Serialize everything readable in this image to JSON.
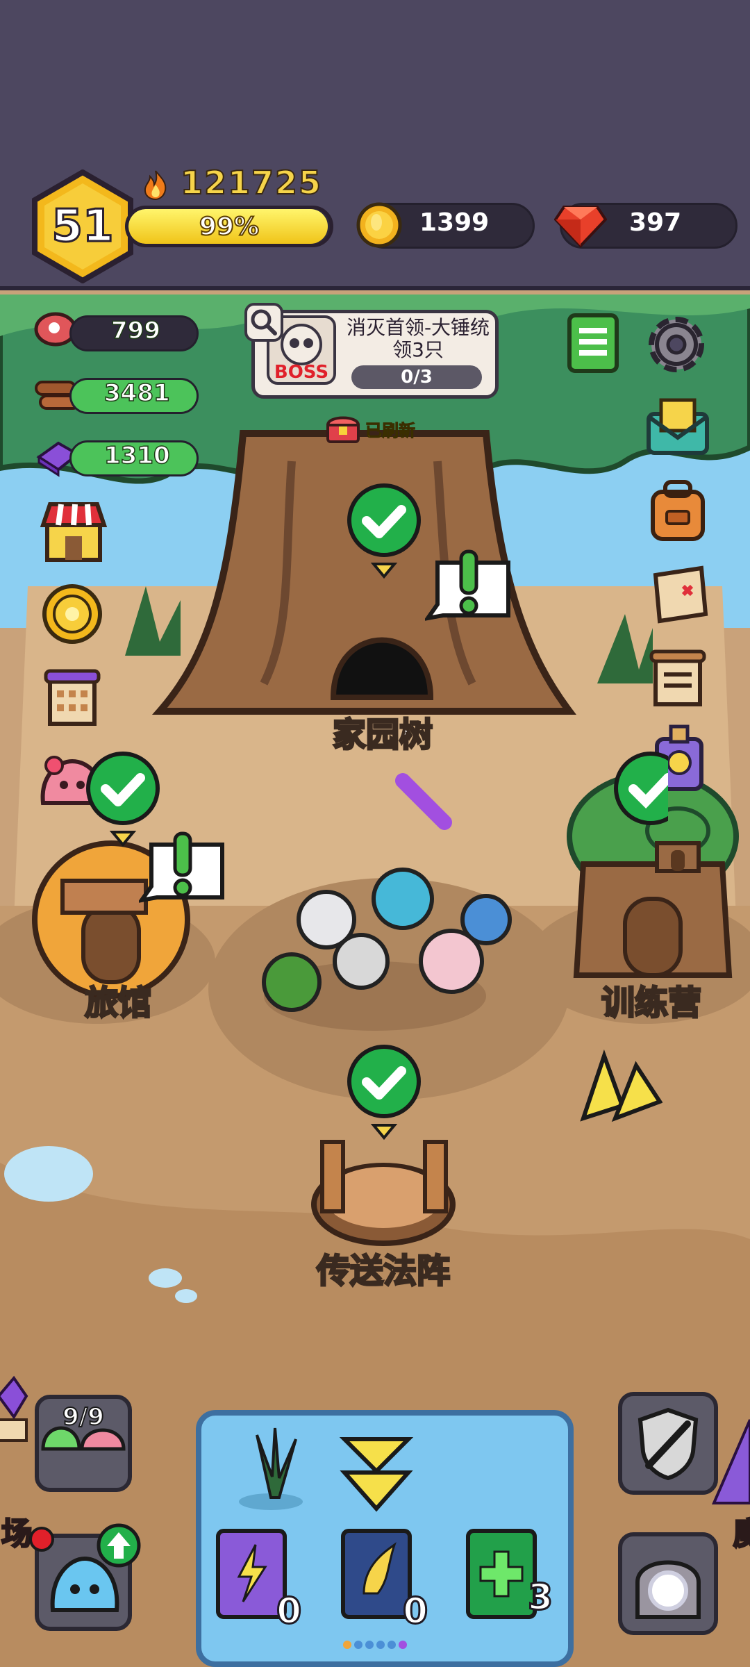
{
  "player": {
    "level": "51",
    "power": "121725",
    "xp_percent": "99%",
    "xp_fraction": 0.99
  },
  "currency": {
    "coins": "1399",
    "gems": "397"
  },
  "resources": [
    {
      "name": "meat",
      "value": "799",
      "fill": 0.0
    },
    {
      "name": "wood",
      "value": "3481",
      "fill": 1.0
    },
    {
      "name": "crystal",
      "value": "1310",
      "fill": 1.0
    }
  ],
  "boss_quest": {
    "badge": "BOSS",
    "title": "消灭首领-大锤统领3只",
    "progress": "0/3"
  },
  "chest_status": "已刷新",
  "buildings": {
    "home_tree": "家园树",
    "inn": "旅馆",
    "training_camp": "训练营",
    "teleport": "传送法阵"
  },
  "slimes": {
    "count": "9/9"
  },
  "books": [
    {
      "name": "lightning-book",
      "count": "0"
    },
    {
      "name": "wing-book",
      "count": "0"
    },
    {
      "name": "heal-book",
      "count": "3"
    }
  ],
  "side_labels": {
    "left": "场",
    "right": "魔"
  },
  "colors": {
    "header": "#4d4760",
    "xp": "#f0c419",
    "resource_bar": "#4cc35a",
    "gem": "#e8402a",
    "check": "#22b04a"
  }
}
